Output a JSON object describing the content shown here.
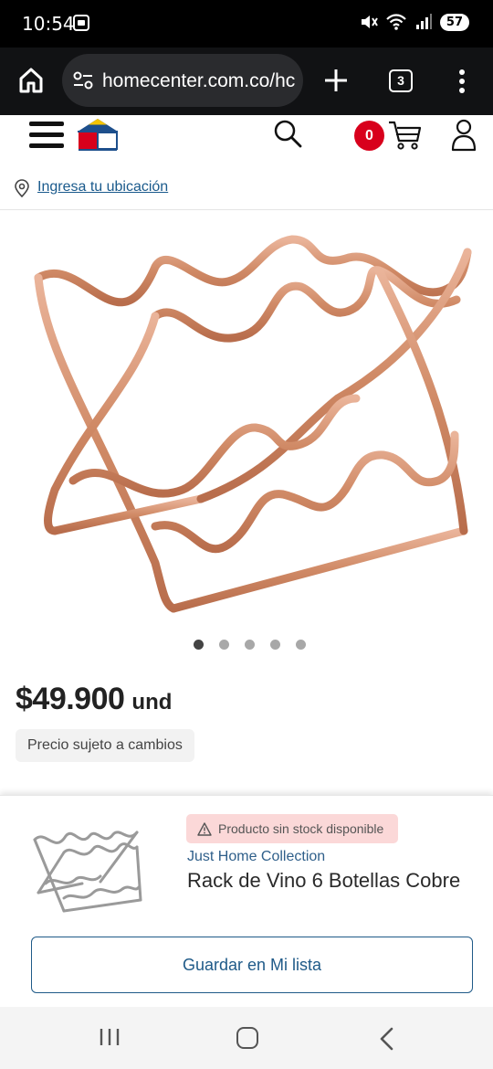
{
  "status_bar": {
    "time": "10:54",
    "battery": "57"
  },
  "browser": {
    "url": "homecenter.com.co/hc",
    "tab_count": "3"
  },
  "header": {
    "cart_count": "0"
  },
  "location": {
    "link_label": "Ingresa tu ubicación"
  },
  "product": {
    "image_dot_count": 5,
    "active_dot_index": 0,
    "price": "$49.900",
    "price_unit": "und",
    "price_note": "Precio sujeto a cambios"
  },
  "sticky_panel": {
    "stock_badge": "Producto sin stock disponible",
    "brand": "Just Home Collection",
    "product_name": "Rack de Vino 6 Botellas Cobre",
    "save_button": "Guardar en Mi lista"
  },
  "colors": {
    "accent_blue": "#1f5a88",
    "badge_red": "#d8001c",
    "copper": "#d8946f"
  },
  "icons": [
    "home-icon",
    "tune-icon",
    "plus-icon",
    "tabs-icon",
    "more-vert-icon",
    "menu-icon",
    "logo-icon",
    "search-icon",
    "cart-icon",
    "user-icon",
    "location-pin-icon",
    "warning-icon",
    "recent-apps-icon",
    "home-nav-icon",
    "back-icon"
  ]
}
